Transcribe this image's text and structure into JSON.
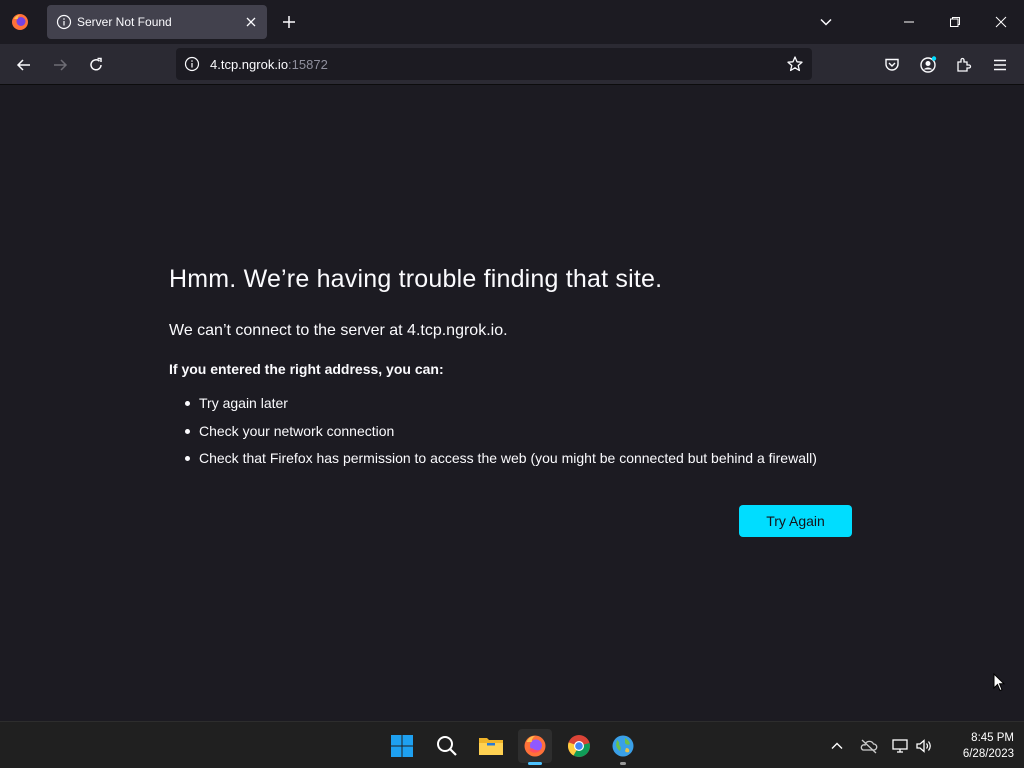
{
  "window": {
    "tab_title": "Server Not Found"
  },
  "navbar": {
    "url_host": "4.tcp.ngrok.io",
    "url_port": ":15872"
  },
  "error": {
    "title": "Hmm. We’re having trouble finding that site.",
    "short_desc": "We can’t connect to the server at 4.tcp.ngrok.io.",
    "subheading": "If you entered the right address, you can:",
    "suggestions": [
      "Try again later",
      "Check your network connection",
      "Check that Firefox has permission to access the web (you might be connected but behind a firewall)"
    ],
    "try_again_label": "Try Again"
  },
  "taskbar": {
    "apps": [
      "start-icon",
      "search-icon",
      "file-explorer-icon",
      "firefox-icon",
      "chrome-icon",
      "globe-app-icon"
    ],
    "time": "8:45 PM",
    "date": "6/28/2023"
  },
  "colors": {
    "page_bg": "#1c1b22",
    "toolbar_bg": "#2b2a33",
    "accent_button": "#00ddff"
  }
}
